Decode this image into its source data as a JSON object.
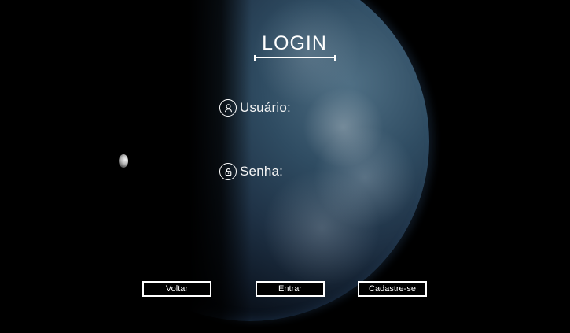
{
  "login": {
    "title": "LOGIN"
  },
  "fields": {
    "user_label": "Usuário:",
    "password_label": "Senha:"
  },
  "buttons": {
    "back": "Voltar",
    "enter": "Entrar",
    "signup": "Cadastre-se"
  },
  "icons": {
    "user": "user-icon",
    "lock": "lock-icon"
  },
  "colors": {
    "background": "#000000",
    "text": "#ffffff",
    "earth_blue": "#4f6f84"
  }
}
